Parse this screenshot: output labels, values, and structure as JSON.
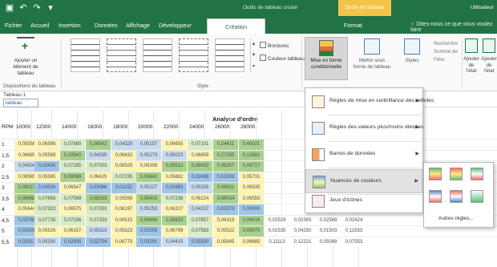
{
  "titlebar": {
    "quick_access": [
      "▣",
      "↶",
      "↷",
      "▾"
    ],
    "doc_title": "Outils de tableau croisé",
    "context_tools": "Outils de tableau",
    "user": "Utilisateur"
  },
  "tabs": [
    {
      "label": "Fichier"
    },
    {
      "label": "Accueil"
    },
    {
      "label": "Insertion"
    },
    {
      "label": "Données"
    },
    {
      "label": "Affichage"
    },
    {
      "label": "Développeur"
    },
    {
      "label": "Création"
    },
    {
      "label": "Format"
    }
  ],
  "tellme": "♀ Dites-nous ce que vous voulez faire",
  "ribbon": {
    "add_elements": "Ajouter un élément de tableau",
    "dispositions": "Dispositions du tableau",
    "styles_label": "Style",
    "borders": "Bordures",
    "fill": "Couleur tableau",
    "cond_format": "Mise en forme conditionnelle",
    "format_table": "Mettre sous forme de tableau",
    "cell_styles": "Styles",
    "small_opts": [
      "Recherche",
      "Somme de",
      "Filtre"
    ],
    "right1": "Ajouter de l'état",
    "right2": "Ajouter de l'état"
  },
  "formula_bar": {
    "tab_name": "Tableau 1",
    "close": "tableau"
  },
  "sheet": {
    "title": "Analyse d'ordre",
    "corner": "RPM",
    "headers": [
      "10000",
      "12000",
      "14000",
      "16000",
      "18000",
      "20000",
      "22000",
      "24000",
      "26000",
      "28000"
    ],
    "rows": [
      {
        "label": "1",
        "cells": [
          "0,05556",
          "0,06598",
          "0,07880",
          "0,08542",
          "0,04325",
          "0,05157",
          "0,06655",
          "0,07101",
          "0,24421",
          "0,40021"
        ]
      },
      {
        "label": "1,5",
        "cells": [
          "0,06685",
          "0,05589",
          "0,10542",
          "0,04335",
          "0,06632",
          "0,05273",
          "0,05023",
          "0,06659",
          "0,27255",
          "0,13581"
        ]
      },
      {
        "label": "2",
        "cells": [
          "0,04504",
          "0,03436",
          "0,07285",
          "0,07003",
          "0,06525",
          "0,06306",
          "0,08512",
          "0,08002",
          "0,08357",
          "0,09717"
        ]
      },
      {
        "label": "2,5",
        "cells": [
          "0,06565",
          "0,05585",
          "0,09068",
          "0,06425",
          "0,07235",
          "0,08442",
          "0,05882",
          "0,02489",
          "0,01509",
          "0,05731"
        ]
      },
      {
        "label": "3",
        "cells": [
          "0,09217",
          "0,03530",
          "0,06547",
          "0,03086",
          "0,01152",
          "0,05227",
          "0,02959",
          "0,05325",
          "0,08921",
          "0,06535"
        ]
      },
      {
        "label": "3,5",
        "cells": [
          "0,08868",
          "0,07658",
          "0,07998",
          "0,08333",
          "0,05599",
          "0,08403",
          "0,07238",
          "0,06224",
          "0,08034",
          "0,06555"
        ]
      },
      {
        "label": "4",
        "cells": [
          "0,05644",
          "0,07323",
          "0,06575",
          "0,07353",
          "0,06197",
          "0,05253",
          "0,06227",
          "0,04237",
          "0,01573",
          "0,00000"
        ]
      },
      {
        "label": "4,5",
        "cells": [
          "0,03788",
          "0,07735",
          "0,07336",
          "0,07333",
          "0,06515",
          "0,08494",
          "0,08833",
          "0,07857",
          "0,06319",
          "0,09416",
          "0,02529",
          "0,02383",
          "0,02568",
          "0,02424"
        ]
      },
      {
        "label": "5",
        "cells": [
          "0,03301",
          "0,05526",
          "0,06157",
          "0,05323",
          "0,05523",
          "0,02509",
          "0,06799",
          "0,07583",
          "0,05522",
          "0,09975",
          "0,01535",
          "0,04250",
          "0,01503",
          "0,11553"
        ]
      },
      {
        "label": "5,5",
        "cells": [
          "0,03313",
          "0,05330",
          "0,02905",
          "0,02754",
          "0,06775",
          "0,03291",
          "0,04415",
          "0,03330",
          "0,05645",
          "0,06685",
          "0,11113",
          "0,12221",
          "0,05099",
          "0,07553"
        ]
      }
    ]
  },
  "menu": {
    "items": [
      {
        "label": "Règles de mise en surbrillance des cellules"
      },
      {
        "label": "Règles des valeurs plus/moins élevées"
      },
      {
        "label": "Barres de données"
      },
      {
        "label": "Nuances de couleurs"
      },
      {
        "label": "Jeux d'icônes"
      }
    ],
    "more_rules": "Autres règles..."
  },
  "colors": {
    "excel_green": "#217346",
    "context_yellow": "#f4c34a",
    "scale_low": "#6fa8dc",
    "scale_mid": "#fff4b3",
    "scale_high": "#93c47d"
  }
}
